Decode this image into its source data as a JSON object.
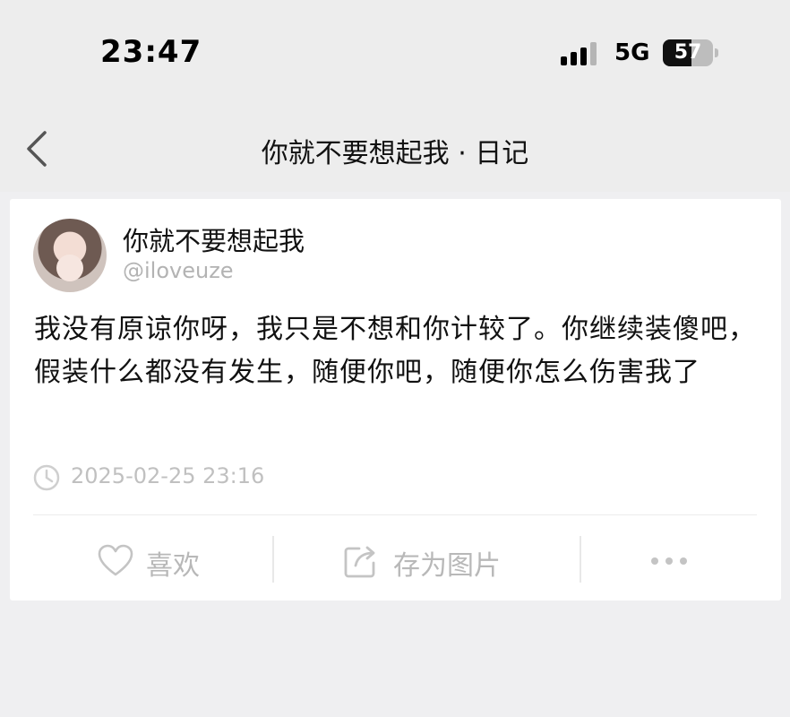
{
  "status_bar": {
    "time": "23:47",
    "network": "5G",
    "battery": "57",
    "battery_level": 0.57
  },
  "nav": {
    "back_icon": "chevron-left-icon",
    "title": "你就不要想起我 · 日记"
  },
  "post": {
    "author_name": "你就不要想起我",
    "author_handle": "@iloveuze",
    "content": "我没有原谅你呀，我只是不想和你计较了。你继续装傻吧，假装什么都没有发生，随便你吧，随便你怎么伤害我了",
    "timestamp": "2025-02-25 23:16"
  },
  "actions": {
    "like": {
      "icon": "heart-icon",
      "label": "喜欢"
    },
    "save_image": {
      "icon": "share-export-icon",
      "label": "存为图片"
    },
    "more": {
      "icon": "more-dots-icon"
    }
  },
  "colors": {
    "background": "#efeff1",
    "card": "#ffffff",
    "muted_text": "#b8b8b8"
  }
}
